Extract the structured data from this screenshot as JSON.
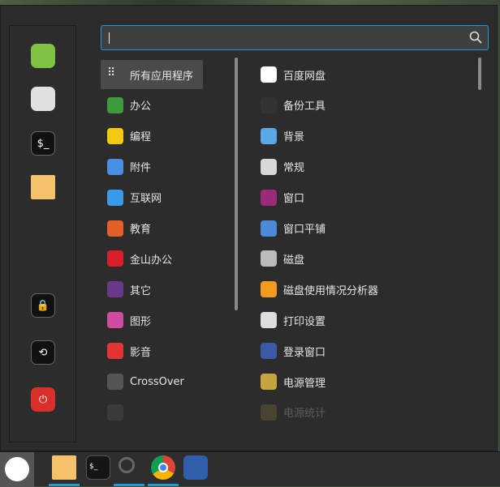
{
  "search": {
    "value": "",
    "icon": "search-icon"
  },
  "sidebar": [
    {
      "name": "software-manager",
      "color": "#7dc242"
    },
    {
      "name": "settings",
      "color": "#e0e0e0"
    },
    {
      "name": "terminal",
      "color": "#111111"
    },
    {
      "name": "files",
      "color": "#f5c26b"
    },
    {
      "name": "lock-screen",
      "color": "#111111"
    },
    {
      "name": "logout",
      "color": "#111111"
    },
    {
      "name": "shutdown",
      "color": "#d9302b"
    }
  ],
  "categories": [
    {
      "label": "所有应用程序",
      "color": "#4a4a4a",
      "selected": true
    },
    {
      "label": "办公",
      "color": "#3c9a3a"
    },
    {
      "label": "编程",
      "color": "#f2c811"
    },
    {
      "label": "附件",
      "color": "#4a90e2"
    },
    {
      "label": "互联网",
      "color": "#3a9ae8"
    },
    {
      "label": "教育",
      "color": "#e25f2a"
    },
    {
      "label": "金山办公",
      "color": "#d8202a"
    },
    {
      "label": "其它",
      "color": "#6a3a8a"
    },
    {
      "label": "图形",
      "color": "#d04ca0"
    },
    {
      "label": "影音",
      "color": "#e33333"
    },
    {
      "label": "CrossOver",
      "color": "#555555"
    },
    {
      "label": "",
      "color": "#666666",
      "faded": true
    }
  ],
  "apps": [
    {
      "label": "百度网盘",
      "color": "#ffffff"
    },
    {
      "label": "备份工具",
      "color": "#333333"
    },
    {
      "label": "背景",
      "color": "#5aa9e6"
    },
    {
      "label": "常规",
      "color": "#d8d8d8"
    },
    {
      "label": "窗口",
      "color": "#9a2a7a"
    },
    {
      "label": "窗口平铺",
      "color": "#4a8ad8"
    },
    {
      "label": "磁盘",
      "color": "#bbbbbb"
    },
    {
      "label": "磁盘使用情况分析器",
      "color": "#f59a1e"
    },
    {
      "label": "打印设置",
      "color": "#dddddd"
    },
    {
      "label": "登录窗口",
      "color": "#3a5aa8"
    },
    {
      "label": "电源管理",
      "color": "#c8a440"
    },
    {
      "label": "电源统计",
      "color": "#a08a40",
      "faded": true
    }
  ],
  "taskbar": [
    {
      "name": "menu",
      "color": "#555555"
    },
    {
      "name": "files",
      "color": "#f5c26b",
      "active": true
    },
    {
      "name": "terminal",
      "color": "#151515"
    },
    {
      "name": "search",
      "color": "#2e2e2e",
      "active": true
    },
    {
      "name": "chrome",
      "color": "#db4437",
      "active": true
    },
    {
      "name": "screenshot",
      "color": "#2f5fa8"
    }
  ]
}
